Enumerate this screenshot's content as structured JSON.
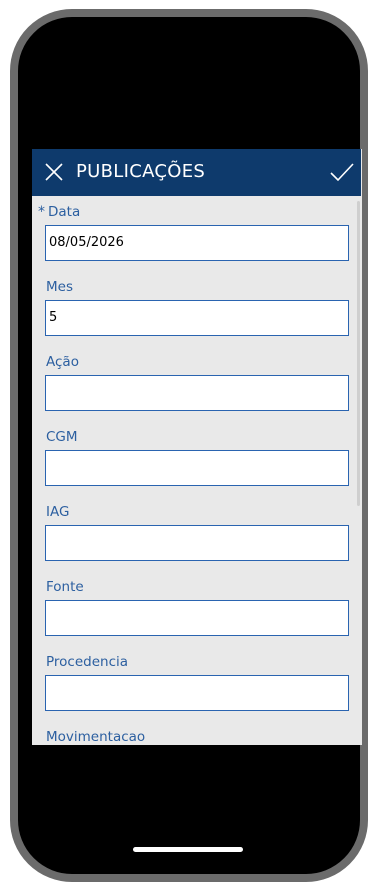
{
  "header": {
    "title": "PUBLICAÇÕES",
    "close_icon": "close-icon",
    "confirm_icon": "checkmark-icon",
    "background_color": "#0e3a6c"
  },
  "form": {
    "fields": [
      {
        "label": "Data",
        "required": "*",
        "value": "08/05/2026"
      },
      {
        "label": "Mes",
        "value": "5"
      },
      {
        "label": "Ação",
        "value": ""
      },
      {
        "label": "CGM",
        "value": ""
      },
      {
        "label": "IAG",
        "value": ""
      },
      {
        "label": "Fonte",
        "value": ""
      },
      {
        "label": "Procedencia",
        "value": ""
      },
      {
        "label": "Movimentacao"
      }
    ]
  },
  "colors": {
    "label": "#2c5fa0",
    "input_border": "#2a64b0",
    "screen_background": "#e9e9e9"
  }
}
